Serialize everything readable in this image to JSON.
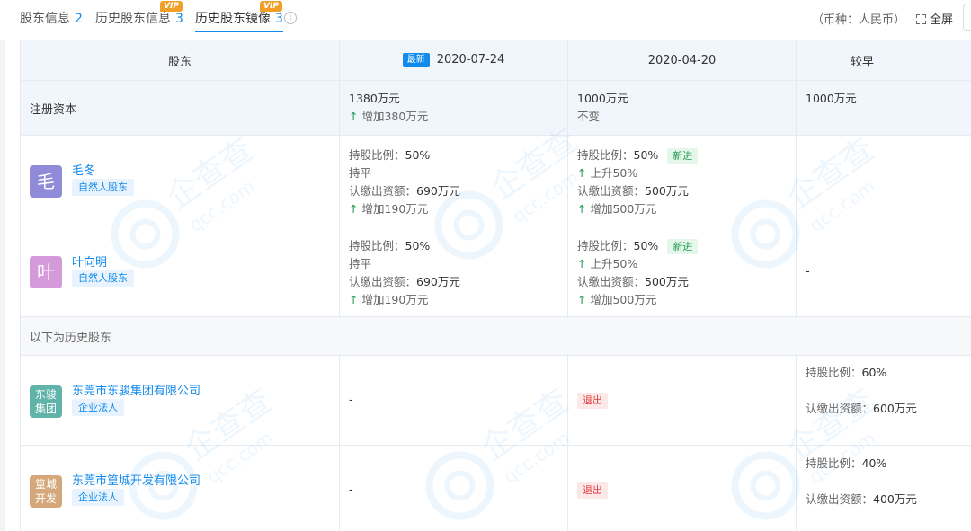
{
  "tabs": [
    {
      "label": "股东信息",
      "count": "2",
      "vip": ""
    },
    {
      "label": "历史股东信息",
      "count": "3",
      "vip": "VIP"
    },
    {
      "label": "历史股东镜像",
      "count": "3",
      "vip": "VIP"
    }
  ],
  "info_icon": "i",
  "currency": "（币种：人民币）",
  "fullscreen": "全屏",
  "table": {
    "header": {
      "shareholder": "股东",
      "latest_badge": "最新",
      "col1": "2020-07-24",
      "col2": "2020-04-20",
      "col3": "较早"
    },
    "registered_capital": {
      "label": "注册资本",
      "col1_value": "1380万元",
      "col1_change": "增加380万元",
      "col2_value": "1000万元",
      "col2_change": "不变",
      "col3_value": "1000万元"
    },
    "current": [
      {
        "avatar": "毛",
        "avatar_color": "#8f8bd9",
        "name": "毛冬",
        "type": "自然人股东",
        "c1": {
          "ratio_label": "持股比例：",
          "ratio": "50%",
          "ratio_change": "持平",
          "sub_label": "认缴出资额：",
          "sub": "690万元",
          "sub_change": "增加190万元"
        },
        "c2": {
          "ratio_label": "持股比例：",
          "ratio": "50%",
          "tag": "新进",
          "ratio_change": "上升50%",
          "sub_label": "认缴出资额：",
          "sub": "500万元",
          "sub_change": "增加500万元"
        },
        "c3": "-"
      },
      {
        "avatar": "叶",
        "avatar_color": "#d59ad9",
        "name": "叶向明",
        "type": "自然人股东",
        "c1": {
          "ratio_label": "持股比例：",
          "ratio": "50%",
          "ratio_change": "持平",
          "sub_label": "认缴出资额：",
          "sub": "690万元",
          "sub_change": "增加190万元"
        },
        "c2": {
          "ratio_label": "持股比例：",
          "ratio": "50%",
          "tag": "新进",
          "ratio_change": "上升50%",
          "sub_label": "认缴出资额：",
          "sub": "500万元",
          "sub_change": "增加500万元"
        },
        "c3": "-"
      }
    ],
    "history_label": "以下为历史股东",
    "history": [
      {
        "avatar": "东骏\n集团",
        "avatar_color": "#5fb3a9",
        "name": "东莞市东骏集团有限公司",
        "type": "企业法人",
        "c1": "-",
        "c2_tag": "退出",
        "c3": {
          "ratio_label": "持股比例：",
          "ratio": "60%",
          "sub_label": "认缴出资额：",
          "sub": "600万元"
        }
      },
      {
        "avatar": "篁城\n开发",
        "avatar_color": "#d4a87a",
        "name": "东莞市篁城开发有限公司",
        "type": "企业法人",
        "c1": "-",
        "c2_tag": "退出",
        "c3": {
          "ratio_label": "持股比例：",
          "ratio": "40%",
          "sub_label": "认缴出资额：",
          "sub": "400万元"
        }
      }
    ]
  },
  "watermark": "企查查 qcc.com",
  "colors": {
    "accent": "#128bed",
    "positive": "#1f9a4f",
    "danger": "#e0393e",
    "vip": "#f0a028"
  },
  "icons": {
    "info": "info-icon",
    "fullscreen": "fullscreen-icon",
    "up": "arrow-up-icon"
  }
}
